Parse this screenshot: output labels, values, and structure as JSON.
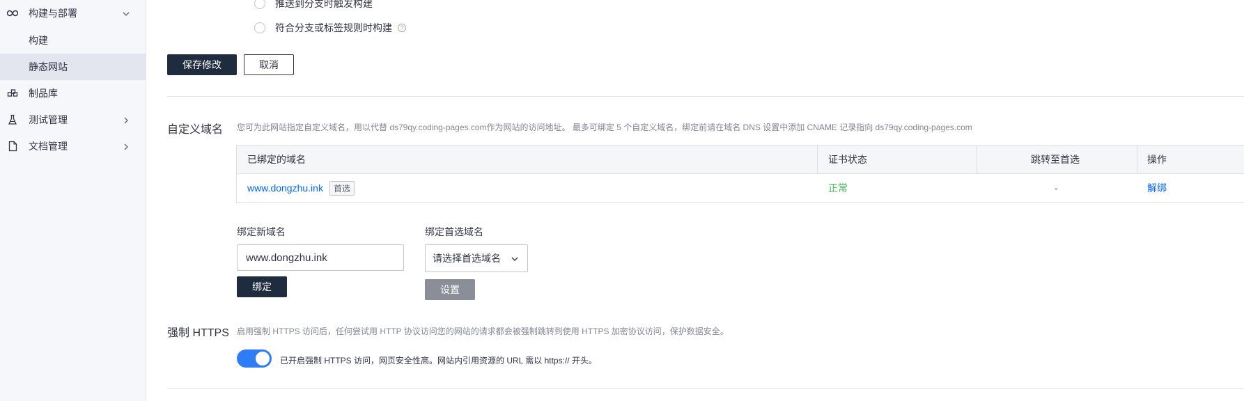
{
  "sidebar": {
    "items": [
      {
        "label": "构建与部署",
        "icon": "infinity-icon",
        "expanded": true
      },
      {
        "label": "构建"
      },
      {
        "label": "静态网站",
        "active": true
      },
      {
        "label": "制品库",
        "icon": "artifact-icon"
      },
      {
        "label": "测试管理",
        "icon": "flask-icon"
      },
      {
        "label": "文档管理",
        "icon": "document-icon"
      }
    ]
  },
  "trigger": {
    "options": [
      "推送到分支时触发构建",
      "符合分支或标签规则时构建"
    ],
    "help_symbol": "?"
  },
  "actions": {
    "save_label": "保存修改",
    "cancel_label": "取消"
  },
  "custom_domain": {
    "title": "自定义域名",
    "description": "您可为此网站指定自定义域名，用以代替 ds79qy.coding-pages.com作为网站的访问地址。 最多可绑定 5 个自定义域名，绑定前请在域名 DNS 设置中添加 CNAME 记录指向 ds79qy.coding-pages.com",
    "table": {
      "headers": [
        "已绑定的域名",
        "证书状态",
        "跳转至首选",
        "操作"
      ],
      "rows": [
        {
          "domain": "www.dongzhu.ink",
          "tag": "首选",
          "cert_status": "正常",
          "redirect": "-",
          "action": "解绑"
        }
      ]
    },
    "bind_new": {
      "label": "绑定新域名",
      "value": "www.dongzhu.ink",
      "button": "绑定"
    },
    "bind_preferred": {
      "label": "绑定首选域名",
      "placeholder": "请选择首选域名",
      "button": "设置"
    }
  },
  "https": {
    "title": "强制 HTTPS",
    "description": "启用强制 HTTPS 访问后，任何尝试用 HTTP 协议访问您的网站的请求都会被强制跳转到使用 HTTPS 加密协议访问，保护数据安全。",
    "enabled": true,
    "status_text": "已开启强制 HTTPS 访问，网页安全性高。网站内引用资源的 URL 需以 https:// 开头。"
  },
  "colors": {
    "primary_dark": "#1f2b3e",
    "link": "#0066ff",
    "success": "#3fb950",
    "toggle_on": "#2e7cf6"
  }
}
